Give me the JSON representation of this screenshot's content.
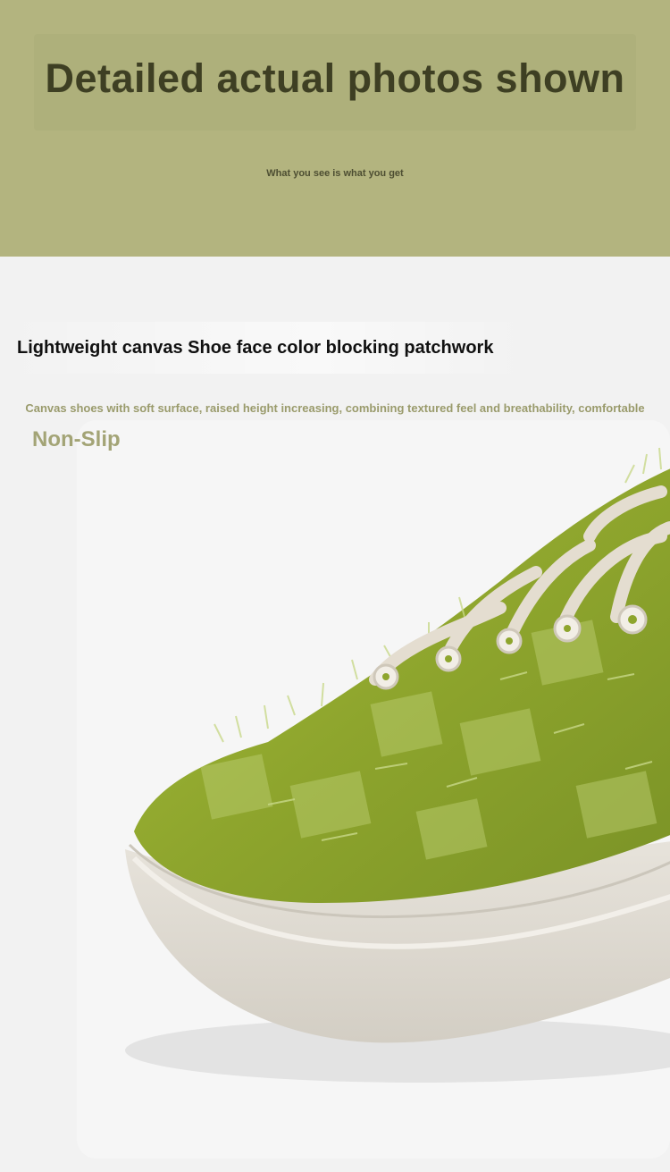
{
  "banner": {
    "title": "Detailed actual photos shown",
    "subtitle": "What you see is what you get",
    "background_color": "#b3b47f"
  },
  "feature": {
    "title": "Lightweight canvas Shoe face color blocking patchwork",
    "description": "Canvas shoes with soft surface, raised height increasing, combining textured feel and breathability, comfortable",
    "tag": "Non-Slip",
    "accent_color": "#a3a476"
  },
  "photo": {
    "subject": "green frayed patchwork canvas sneaker with cream sole and laces"
  }
}
